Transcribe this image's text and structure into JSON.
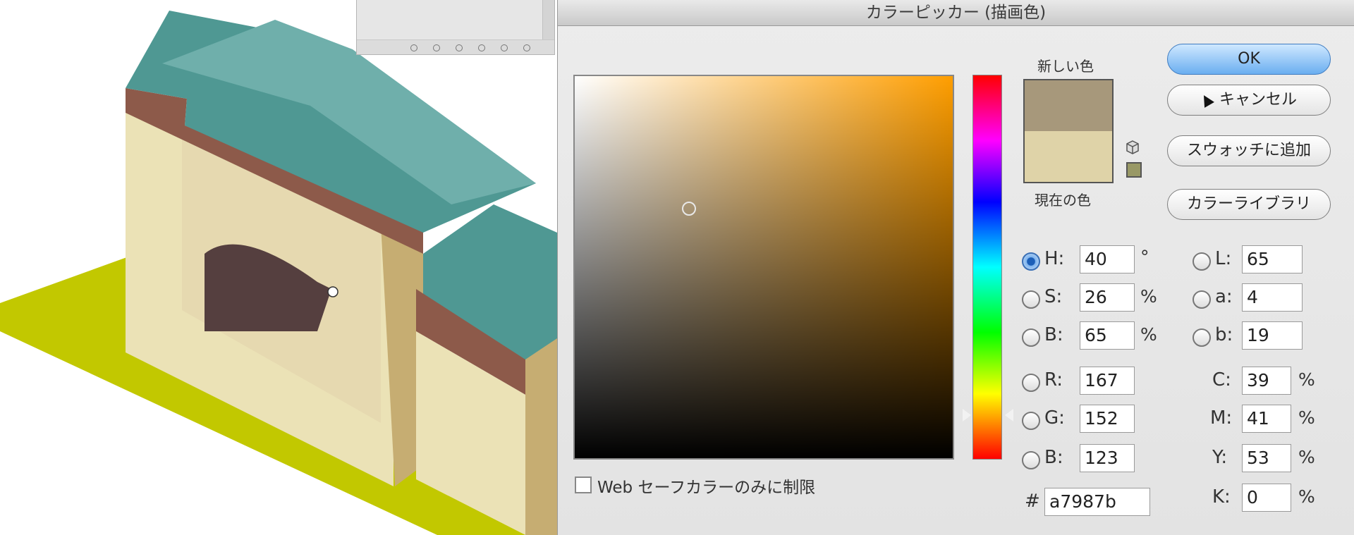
{
  "dialog": {
    "title": "カラーピッカー (描画色)",
    "new_color_label": "新しい色",
    "current_color_label": "現在の色",
    "new_color": "#a7987b",
    "current_color": "#dfd3a8",
    "buttons": {
      "ok": "OK",
      "cancel": "キャンセル",
      "add_swatch": "スウォッチに追加",
      "color_libraries": "カラーライブラリ"
    },
    "fields": {
      "h": {
        "label": "H:",
        "value": "40",
        "unit": "°"
      },
      "s": {
        "label": "S:",
        "value": "26",
        "unit": "%"
      },
      "b": {
        "label": "B:",
        "value": "65",
        "unit": "%"
      },
      "r": {
        "label": "R:",
        "value": "167"
      },
      "g": {
        "label": "G:",
        "value": "152"
      },
      "bl": {
        "label": "B:",
        "value": "123"
      },
      "l": {
        "label": "L:",
        "value": "65"
      },
      "a": {
        "label": "a:",
        "value": "4"
      },
      "lab_b": {
        "label": "b:",
        "value": "19"
      },
      "c": {
        "label": "C:",
        "value": "39",
        "unit": "%"
      },
      "m": {
        "label": "M:",
        "value": "41",
        "unit": "%"
      },
      "y": {
        "label": "Y:",
        "value": "53",
        "unit": "%"
      },
      "k": {
        "label": "K:",
        "value": "0",
        "unit": "%"
      }
    },
    "hex_label": "#",
    "hex_value": "a7987b",
    "websafe_label": "Web セーフカラーのみに制限",
    "selected_mode": "H"
  },
  "illustration": {
    "colors": {
      "roof": "#4f9893",
      "roof_light": "#6fafab",
      "beam": "#8d5a4a",
      "wall": "#ebe2b6",
      "wall_shadow": "#c6ad72",
      "arch": "#553f3f",
      "ground": "#c2c800"
    }
  }
}
